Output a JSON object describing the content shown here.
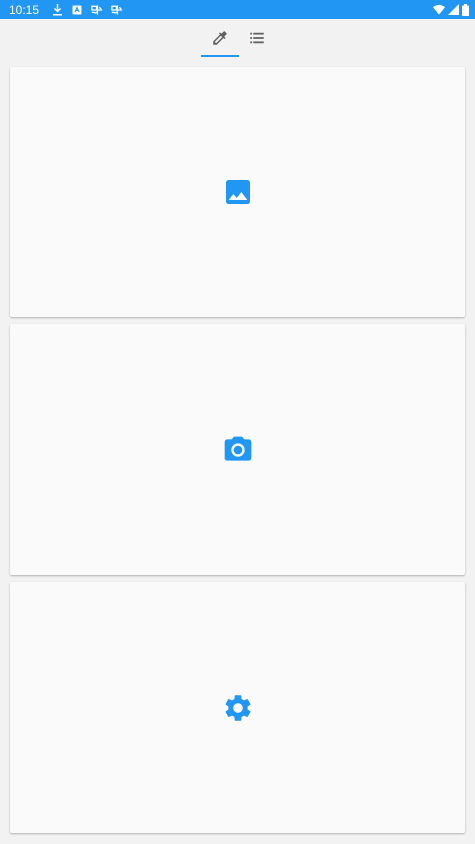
{
  "status_bar": {
    "time": "10:15",
    "icons": [
      "download-icon",
      "notification-icon",
      "app-icon",
      "app-icon",
      "wifi-icon",
      "signal-icon",
      "battery-icon"
    ]
  },
  "tabs": [
    {
      "icon": "eyedropper-icon",
      "active": true
    },
    {
      "icon": "list-icon",
      "active": false
    }
  ],
  "cards": [
    {
      "icon": "image-icon"
    },
    {
      "icon": "camera-icon"
    },
    {
      "icon": "gear-icon"
    }
  ],
  "colors": {
    "accent": "#2196f3",
    "background": "#f2f2f2",
    "card": "#fafafa",
    "tab_icon": "#616161"
  }
}
